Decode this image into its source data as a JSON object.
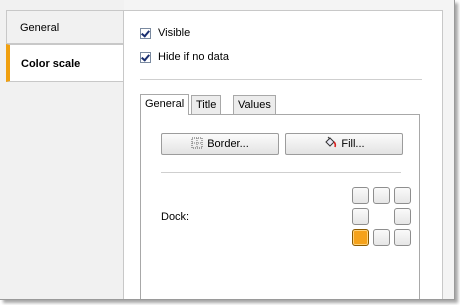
{
  "side_tabs": [
    {
      "label": "General",
      "active": false
    },
    {
      "label": "Color scale",
      "active": true
    }
  ],
  "options": {
    "visible_label": "Visible",
    "visible_checked": true,
    "hide_if_no_data_label": "Hide if no data",
    "hide_if_no_data_checked": true
  },
  "inner_tabs": [
    {
      "label": "General",
      "selected": true
    },
    {
      "label": "Title",
      "selected": false
    },
    {
      "label": "Values",
      "selected": false
    }
  ],
  "buttons": {
    "border_label": "Border...",
    "border_icon": "border-icon",
    "fill_label": "Fill...",
    "fill_icon": "paint-bucket-icon"
  },
  "dock": {
    "label": "Dock:",
    "selected_position": "bottom-left",
    "accent_color": "#f5a21a"
  },
  "colors": {
    "active_tab_accent": "#f0a010"
  }
}
